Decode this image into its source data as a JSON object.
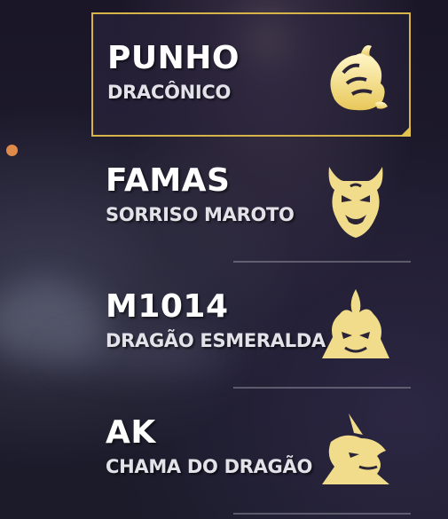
{
  "colors": {
    "accent": "#d6b44a",
    "icon_gold": "#f0dc8a",
    "indicator": "#e08a4a"
  },
  "items": [
    {
      "title": "PUNHO",
      "subtitle": "DRACÔNICO",
      "icon": "dragon-fist-icon",
      "selected": true
    },
    {
      "title": "FAMAS",
      "subtitle": "SORRISO MAROTO",
      "icon": "oni-mask-icon",
      "selected": false
    },
    {
      "title": "M1014",
      "subtitle": "DRAGÃO ESMERALDA",
      "icon": "dragon-head-icon",
      "selected": false
    },
    {
      "title": "AK",
      "subtitle": "CHAMA DO DRAGÃO",
      "icon": "fire-dragon-icon",
      "selected": false
    }
  ]
}
